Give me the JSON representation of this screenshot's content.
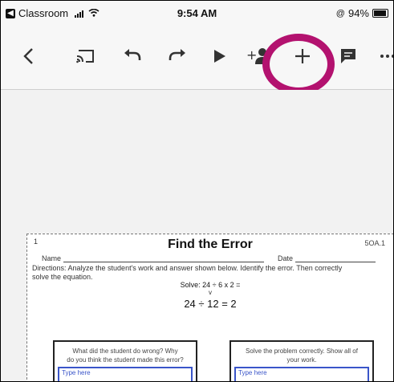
{
  "status_bar": {
    "back_app": "Classroom",
    "time": "9:54 AM",
    "battery": "94%",
    "battery_level": 0.94
  },
  "toolbar": {
    "icons": [
      "back-chevron-icon",
      "cast-icon",
      "undo-icon",
      "redo-icon",
      "play-icon",
      "add-person-icon",
      "add-plus-icon",
      "comment-icon",
      "more-icon"
    ],
    "highlight_color": "#b3126f"
  },
  "worksheet": {
    "page_number": "1",
    "code": "5OA.1",
    "title": "Find the Error",
    "name_label": "Name",
    "date_label": "Date",
    "directions_line1": "Directions: Analyze the student's work and answer shown below. Identify the error. Then correctly",
    "directions_line2": "solve the equation.",
    "solve_prompt": "Solve: 24 ÷ 6 x 2 =",
    "student_work": "24 ÷ 12 = 2",
    "box_left_q1": "What did the student do wrong? Why",
    "box_left_q2": "do you think the student made this error?",
    "box_right_q1": "Solve the problem correctly. Show all of",
    "box_right_q2": "your work.",
    "type_here": "Type here"
  }
}
